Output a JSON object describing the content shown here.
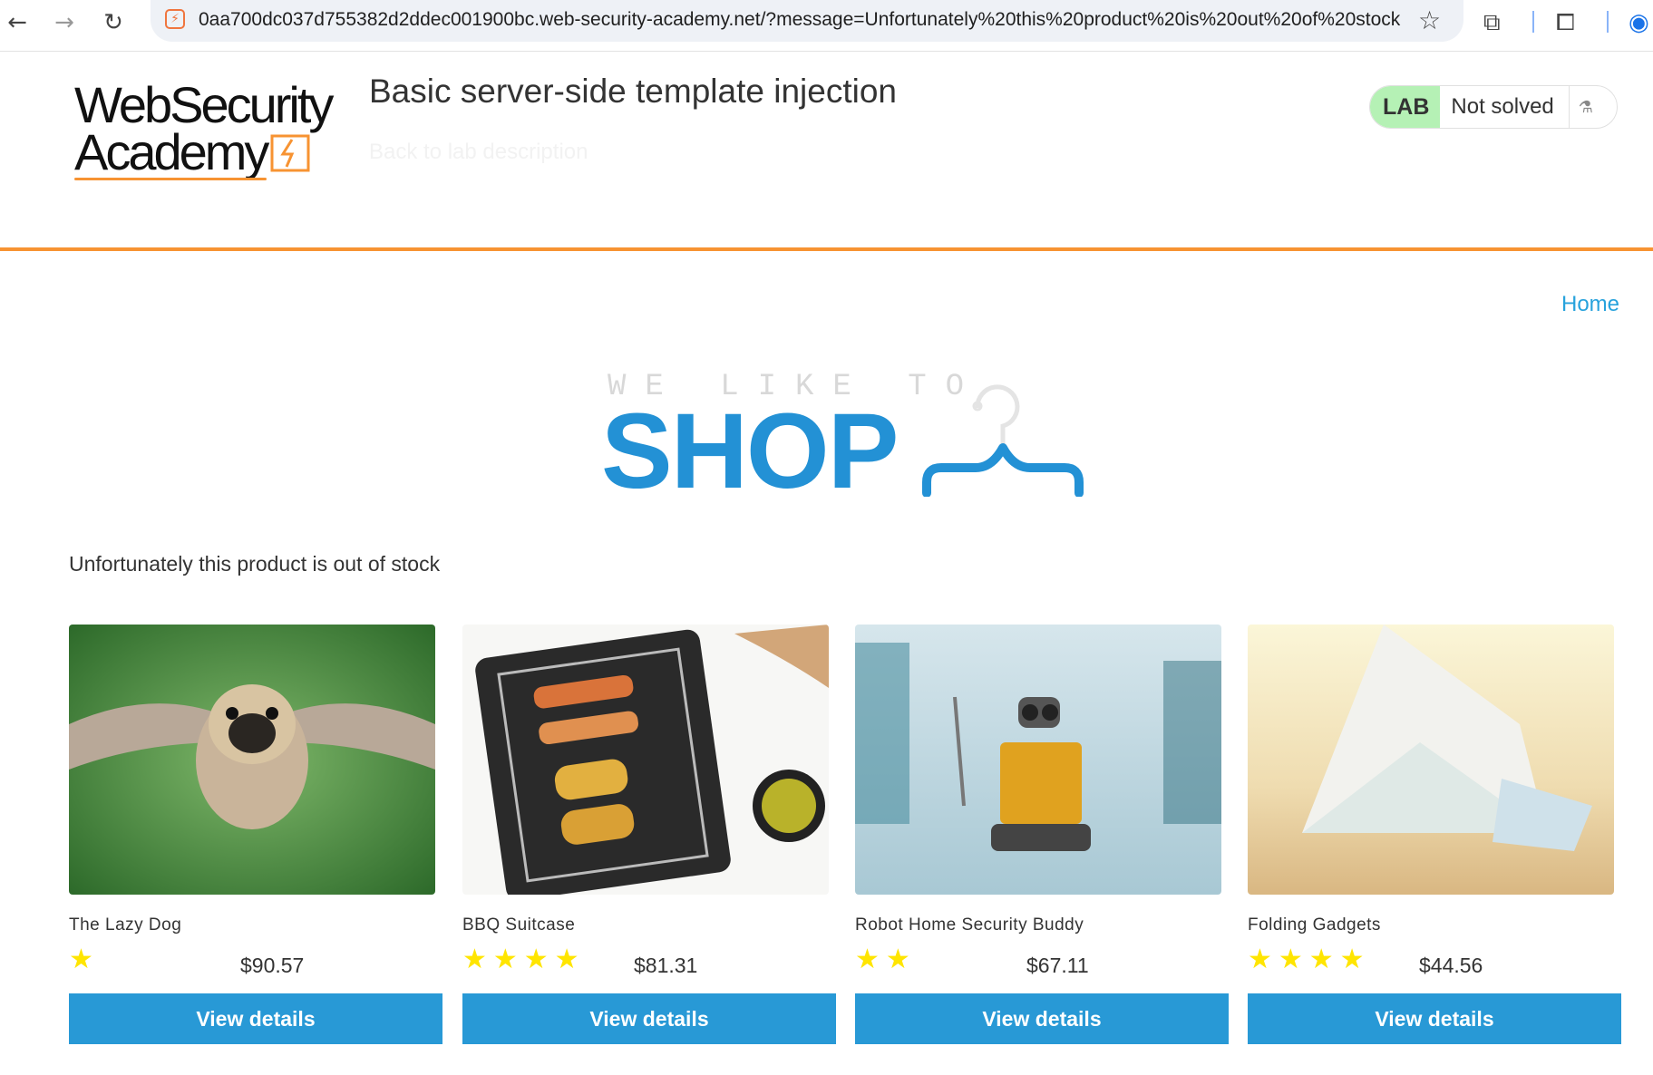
{
  "browser": {
    "url": "0aa700dc037d755382d2ddec001900bc.web-security-academy.net/?message=Unfortunately%20this%20product%20is%20out%20of%20stock",
    "icons": [
      "back-arrow-icon",
      "forward-arrow-icon",
      "reload-icon",
      "bookmark-star-icon",
      "extensions-icon",
      "screen-search-icon",
      "profile-icon"
    ]
  },
  "header": {
    "logo_line1": "WebSecurity",
    "logo_line2": "Academy",
    "lab_title": "Basic server-side template injection",
    "back_link": "Back to lab description",
    "lab_tag": "LAB",
    "lab_state": "Not solved",
    "accent_color": "#f79332",
    "lab_tag_color": "#b5f1b5"
  },
  "nav": {
    "home": "Home"
  },
  "hero": {
    "tagline": "WE LIKE TO",
    "headline": "SHOP",
    "brand_color": "#2391d5"
  },
  "message": "Unfortunately this product is out of stock",
  "products": [
    {
      "name": "The Lazy Dog",
      "rating": 1,
      "stars": "★",
      "price": "$90.57",
      "image": "flying-pug-image",
      "button": "View details"
    },
    {
      "name": "BBQ Suitcase",
      "rating": 4,
      "stars": "★★★★",
      "price": "$81.31",
      "image": "bbq-grill-image",
      "button": "View details"
    },
    {
      "name": "Robot Home Security Buddy",
      "rating": 2,
      "stars": "★★",
      "price": "$67.11",
      "image": "robot-toy-image",
      "button": "View details"
    },
    {
      "name": "Folding Gadgets",
      "rating": 4,
      "stars": "★★★★",
      "price": "$44.56",
      "image": "folded-paper-image",
      "button": "View details"
    }
  ],
  "colors": {
    "button": "#2899d6",
    "star": "#ffe500",
    "link": "#27a2dc"
  }
}
